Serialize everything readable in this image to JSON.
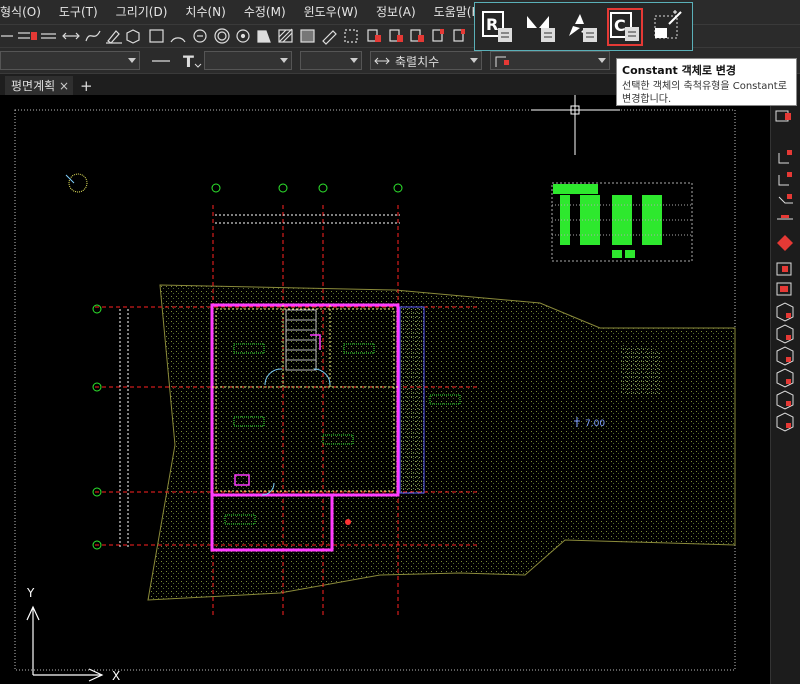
{
  "menu": [
    "형식(O)",
    "도구(T)",
    "그리기(D)",
    "치수(N)",
    "수정(M)",
    "윈도우(W)",
    "정보(A)",
    "도움말(H)"
  ],
  "toolbar2": {
    "scale_combo": "축렬치수"
  },
  "tabs": [
    {
      "label": "평면계획",
      "close": "×"
    }
  ],
  "tab_add": "+",
  "popup": {
    "selected_index": 3
  },
  "tooltip": {
    "title": "Constant 객체로 변경",
    "body": "선택한 객체의 축척유형을 Constant로 변경합니다."
  },
  "canvas": {
    "elevation_label": "7.00",
    "axis_x": "X",
    "axis_y": "Y"
  },
  "colors": {
    "accent": "#5ab0b8",
    "selection": "#e53935",
    "hatch": "#2ee82e",
    "wall": "#ff3cff",
    "grid": "#ff2222"
  }
}
